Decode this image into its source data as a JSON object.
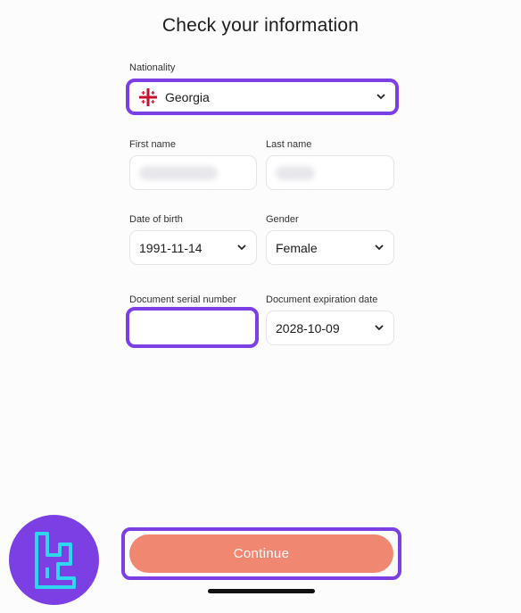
{
  "page": {
    "title": "Check your information"
  },
  "nationality": {
    "label": "Nationality",
    "value": "Georgia",
    "flag_icon": "georgia-flag-icon"
  },
  "first_name": {
    "label": "First name"
  },
  "last_name": {
    "label": "Last name"
  },
  "date_of_birth": {
    "label": "Date of birth",
    "value": "1991-11-14"
  },
  "gender": {
    "label": "Gender",
    "value": "Female"
  },
  "document_serial": {
    "label": "Document serial number",
    "value": ""
  },
  "document_expiration": {
    "label": "Document expiration date",
    "value": "2028-10-09"
  },
  "actions": {
    "continue_label": "Continue"
  },
  "colors": {
    "accent": "#7b3fe4",
    "button": "#ef8771",
    "logo_stroke": "#2fd6f0"
  }
}
